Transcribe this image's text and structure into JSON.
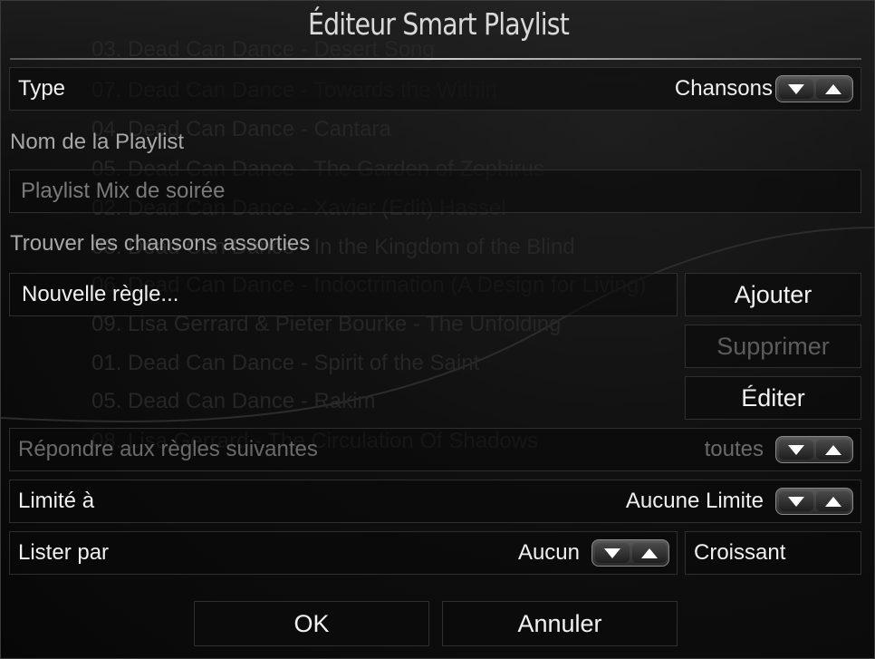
{
  "dialog": {
    "title": "Éditeur Smart Playlist"
  },
  "background_list": [
    "03. Dead Can Dance - Desert Song",
    "07. Dead Can Dance - Towards the Within",
    "04. Dead Can Dance - Cantara",
    "05. Dead Can Dance - The Garden of Zephirus",
    "02. Dead Can Dance - Xavier (Edit) Hassel",
    "08. Dead Can Dance - In the Kingdom of the Blind",
    "06. Dead Can Dance - Indoctrination (A Design for Living)",
    "09. Lisa Gerrard & Pieter Bourke - The Unfolding",
    "01. Dead Can Dance - Spirit of the Saint",
    "05. Dead Can Dance - Rakim",
    "08. Lisa Gerrard - The Circulation Of Shadows"
  ],
  "type_row": {
    "label": "Type",
    "value": "Chansons"
  },
  "name_section": {
    "label": "Nom de la Playlist",
    "value": "Playlist Mix de soirée"
  },
  "rules_section": {
    "label": "Trouver les chansons assorties",
    "rule_item": "Nouvelle règle..."
  },
  "rule_buttons": {
    "add": "Ajouter",
    "remove": "Supprimer",
    "edit": "Éditer"
  },
  "match_row": {
    "label": "Répondre aux règles suivantes",
    "value": "toutes"
  },
  "limit_row": {
    "label": "Limité à",
    "value": "Aucune Limite"
  },
  "order_row": {
    "label": "Lister par",
    "value": "Aucun",
    "direction": "Croissant"
  },
  "footer": {
    "ok": "OK",
    "cancel": "Annuler"
  },
  "icons": {
    "spinner_down": "triangle-down-icon",
    "spinner_up": "triangle-up-icon"
  }
}
